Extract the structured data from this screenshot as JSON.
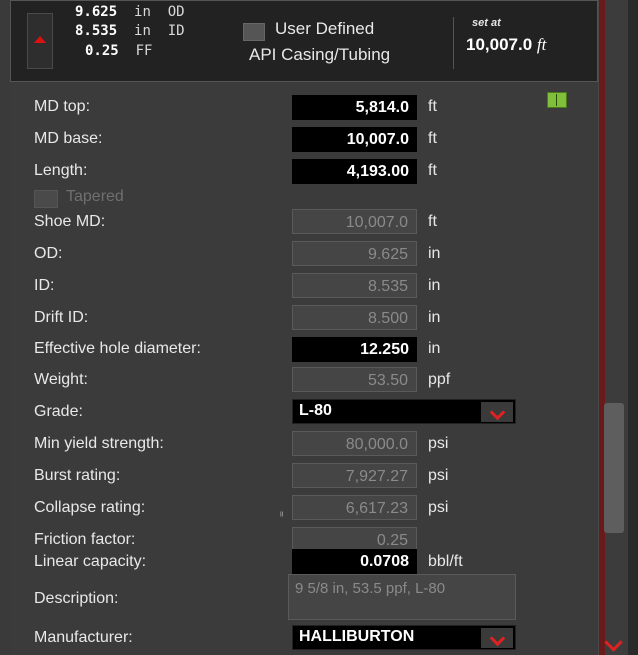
{
  "header": {
    "dims": [
      {
        "value": "9.625",
        "unit": "in",
        "label": "OD"
      },
      {
        "value": "8.535",
        "unit": "in",
        "label": "ID"
      },
      {
        "value": "0.25",
        "unit": "FF",
        "label": ""
      }
    ],
    "user_defined_label": "User Defined",
    "casing_type": "API Casing/Tubing",
    "set_at_label": "set at",
    "set_at_value": "10,007.0",
    "set_at_unit": "ft"
  },
  "fields": {
    "md_top": {
      "label": "MD top:",
      "value": "5,814.0",
      "unit": "ft"
    },
    "md_base": {
      "label": "MD base:",
      "value": "10,007.0",
      "unit": "ft"
    },
    "length": {
      "label": "Length:",
      "value": "4,193.00",
      "unit": "ft"
    },
    "tapered": {
      "label": "Tapered"
    },
    "shoe_md": {
      "label": "Shoe MD:",
      "value": "10,007.0",
      "unit": "ft"
    },
    "od": {
      "label": "OD:",
      "value": "9.625",
      "unit": "in"
    },
    "id": {
      "label": "ID:",
      "value": "8.535",
      "unit": "in"
    },
    "drift_id": {
      "label": "Drift ID:",
      "value": "8.500",
      "unit": "in"
    },
    "effective_hole_diameter": {
      "label": "Effective hole diameter:",
      "value": "12.250",
      "unit": "in"
    },
    "weight": {
      "label": "Weight:",
      "value": "53.50",
      "unit": "ppf"
    },
    "grade": {
      "label": "Grade:",
      "value": "L-80"
    },
    "min_yield": {
      "label": "Min yield strength:",
      "value": "80,000.0",
      "unit": "psi"
    },
    "burst": {
      "label": "Burst rating:",
      "value": "7,927.27",
      "unit": "psi"
    },
    "collapse": {
      "label": "Collapse rating:",
      "value": "6,617.23",
      "unit": "psi"
    },
    "friction": {
      "label": "Friction factor:",
      "value": "0.25",
      "marker": "ᴵᴵ"
    },
    "linear_capacity": {
      "label": "Linear capacity:",
      "value": "0.0708",
      "unit": "bbl/ft"
    },
    "description": {
      "label": "Description:",
      "value": "9 5/8 in, 53.5 ppf, L-80"
    },
    "manufacturer": {
      "label": "Manufacturer:",
      "value": "HALLIBURTON"
    }
  },
  "icons": {
    "book": "book-icon"
  }
}
